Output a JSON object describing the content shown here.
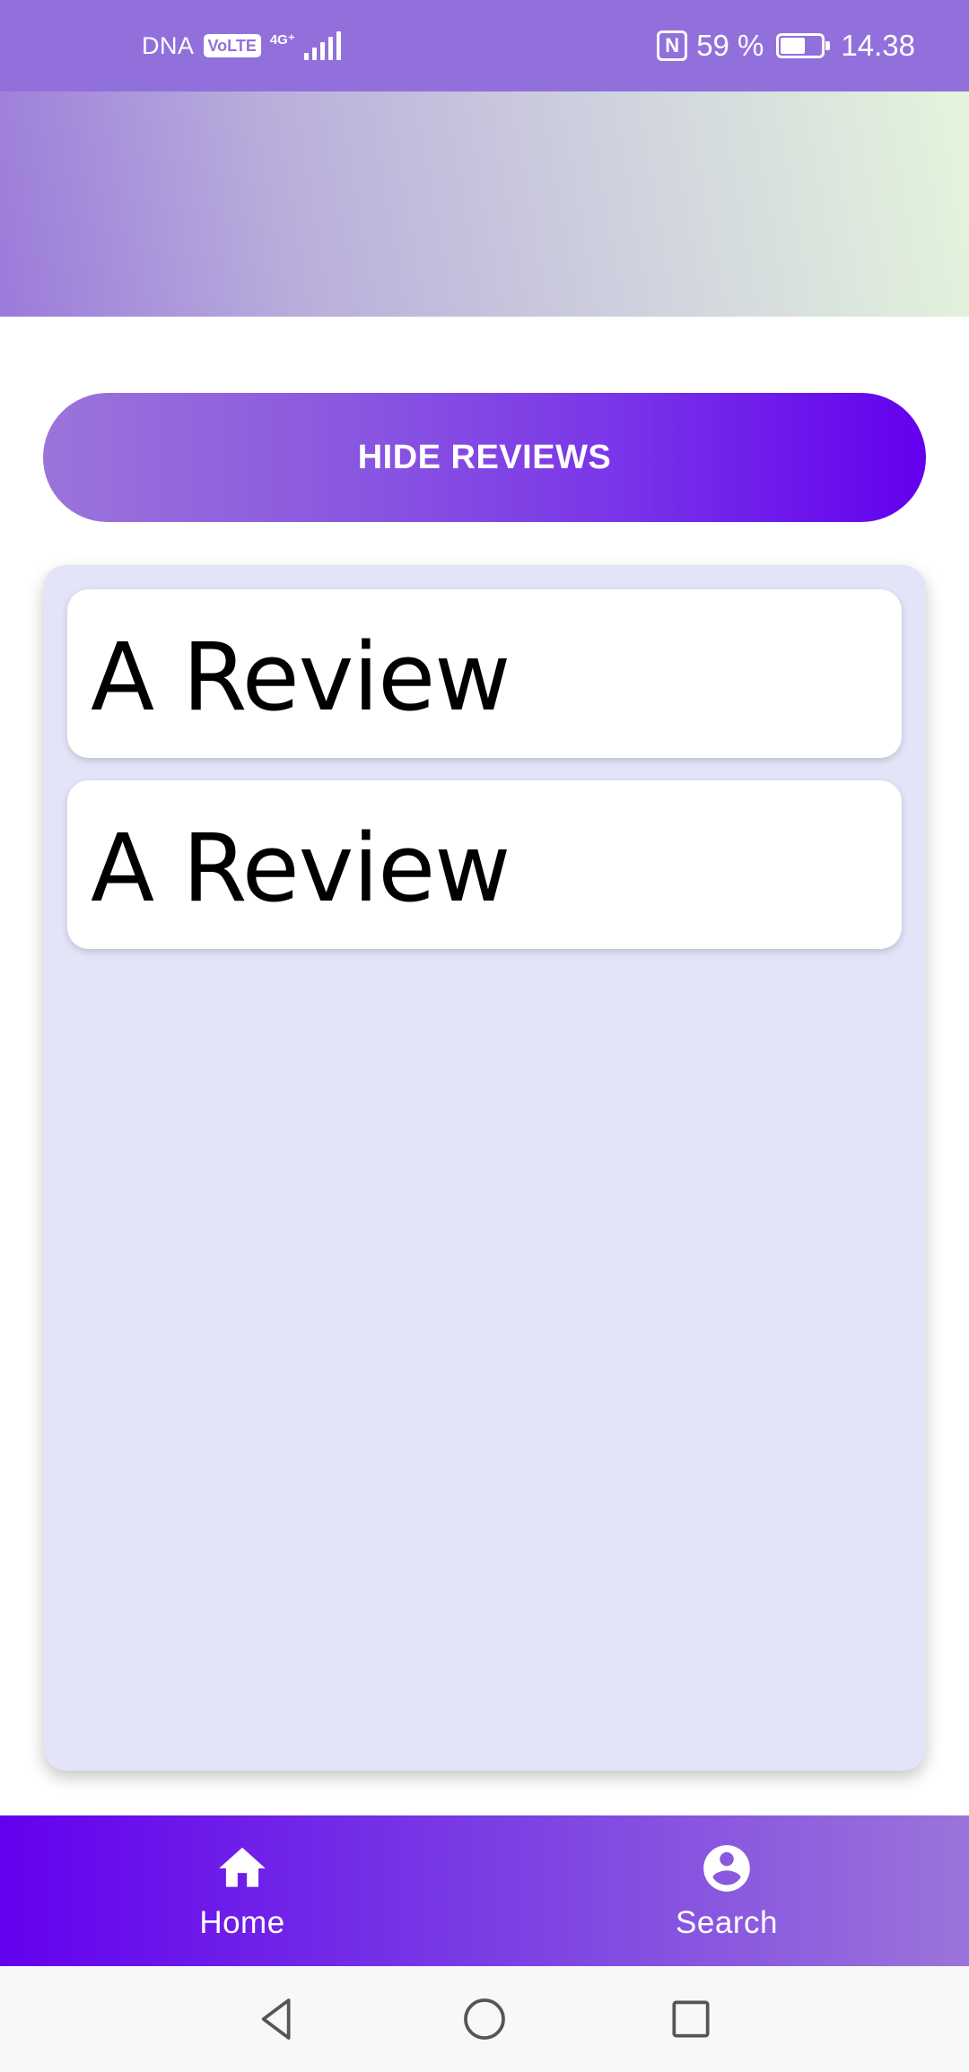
{
  "status_bar": {
    "carrier": "DNA",
    "volte": "VoLTE",
    "network": "4G⁺",
    "battery_percent": "59 %",
    "battery_level": 0.59,
    "time": "14.38",
    "icons": [
      "volte-icon",
      "signal-icon",
      "nfc-icon",
      "battery-icon"
    ]
  },
  "main": {
    "toggle_button_label": "HIDE REVIEWS",
    "reviews": [
      {
        "text": "A Review"
      },
      {
        "text": "A Review"
      }
    ]
  },
  "bottom_nav": {
    "items": [
      {
        "label": "Home",
        "icon": "home-icon"
      },
      {
        "label": "Search",
        "icon": "account-circle-icon"
      }
    ]
  },
  "system_nav": {
    "icons": [
      "back-icon",
      "home-circle-icon",
      "recents-icon"
    ]
  },
  "colors": {
    "status_bar": "#9270DC",
    "accent": "#6300EE",
    "panel_background": "#E4E4F8"
  }
}
